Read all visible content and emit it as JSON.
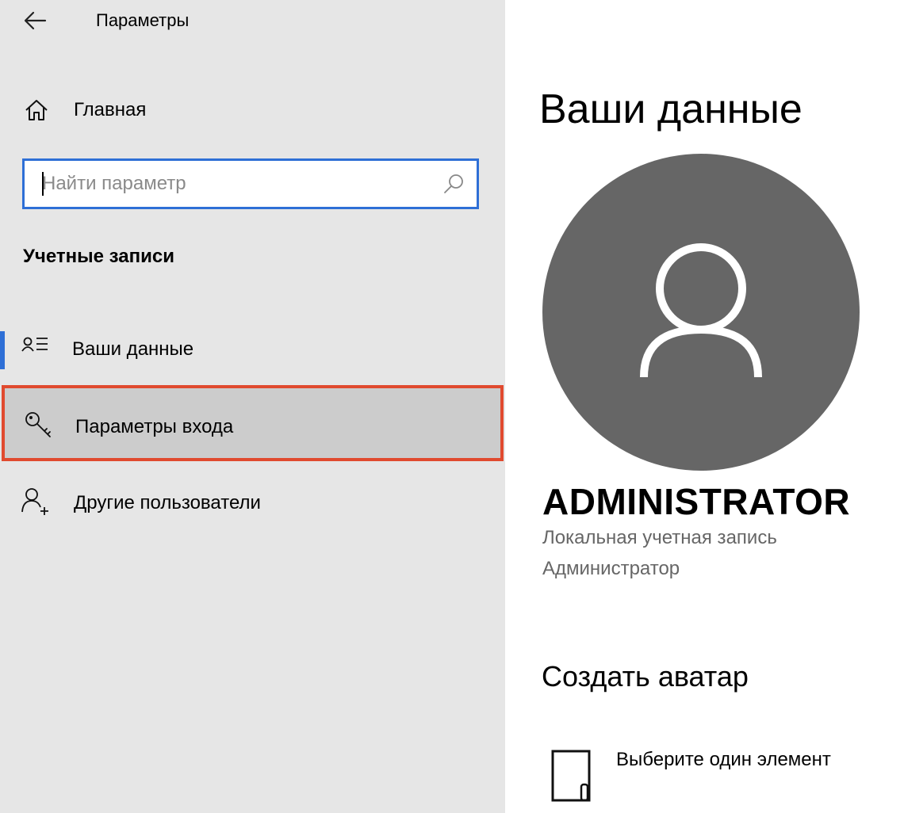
{
  "header": {
    "title": "Параметры",
    "back_icon": "back-arrow-icon"
  },
  "sidebar": {
    "home_label": "Главная",
    "home_icon": "home-icon",
    "search": {
      "placeholder": "Найти параметр",
      "value": "",
      "icon": "search-icon"
    },
    "section_title": "Учетные записи",
    "items": [
      {
        "label": "Ваши данные",
        "icon": "user-details-icon",
        "active": true
      },
      {
        "label": "Параметры входа",
        "icon": "key-icon",
        "highlighted": true
      },
      {
        "label": "Другие пользователи",
        "icon": "add-user-icon"
      }
    ]
  },
  "main": {
    "title": "Ваши данные",
    "avatar_icon": "user-avatar-icon",
    "user_name": "ADMINISTRATOR",
    "account_type": "Локальная учетная запись",
    "account_role": "Администратор",
    "create_avatar_title": "Создать аватар",
    "choose_item_label": "Выберите один элемент",
    "choose_item_icon": "file-browse-icon"
  },
  "colors": {
    "sidebar_bg": "#e6e6e6",
    "accent": "#2e6fd6",
    "highlight_border": "#e04a2f",
    "selected_bg": "#cccccc",
    "avatar_bg": "#666666",
    "secondary_text": "#666666"
  }
}
